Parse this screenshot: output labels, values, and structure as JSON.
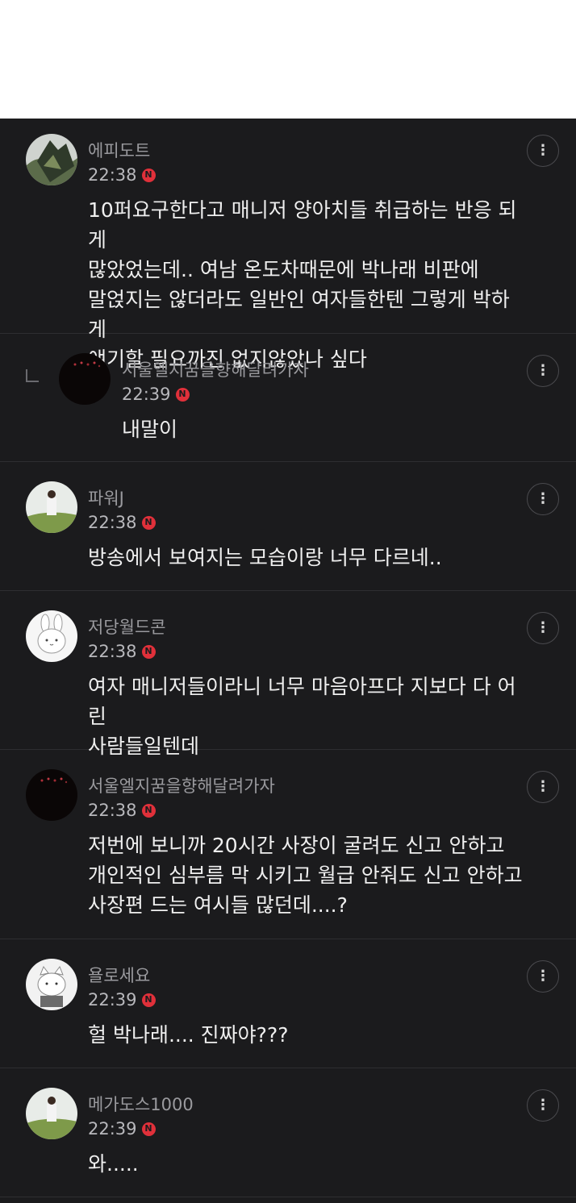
{
  "comments": [
    {
      "author": "에피도트",
      "time": "22:38",
      "badge": "N",
      "text": "10퍼요구한다고 매니저 양아치들 취급하는 반응 되게\n많았었는데.. 여남 온도차때문에 박나래 비판에\n말얹지는 않더라도 일반인 여자들한텐 그렇게 박하게\n얘기할 필요까진 없지않았나 싶다",
      "avatar": "landscape-photo"
    },
    {
      "author": "서울엘지꿈을향해달려가자",
      "time": "22:39",
      "badge": "N",
      "text": "내말이",
      "avatar": "dark-photo",
      "is_reply": true
    },
    {
      "author": "파워J",
      "time": "22:38",
      "badge": "N",
      "text": "방송에서 보여지는 모습이랑 너무 다르네..",
      "avatar": "person-photo"
    },
    {
      "author": "저당월드콘",
      "time": "22:38",
      "badge": "N",
      "text": "여자 매니저들이라니 너무 마음아프다 지보다 다 어린\n사람들일텐데",
      "avatar": "rabbit-illustration"
    },
    {
      "author": "서울엘지꿈을향해달려가자",
      "time": "22:38",
      "badge": "N",
      "text": "저번에 보니까 20시간 사장이 굴려도 신고 안하고\n개인적인 심부름 막 시키고 월급 안줘도 신고 안하고\n사장편 드는 여시들 많던데....?",
      "avatar": "dark-photo"
    },
    {
      "author": "욜로세요",
      "time": "22:39",
      "badge": "N",
      "text": "헐 박나래.... 진짜야???",
      "avatar": "cat-illustration"
    },
    {
      "author": "메가도스1000",
      "time": "22:39",
      "badge": "N",
      "text": "와.....",
      "avatar": "person-photo"
    }
  ],
  "icons": {
    "more": "more-vertical-icon",
    "reply": "reply-arrow-icon",
    "new_badge": "new-badge-icon"
  },
  "colors": {
    "background": "#1b1b1d",
    "badge": "#e0303a",
    "author": "#9a9a9e",
    "text": "#efefef"
  }
}
